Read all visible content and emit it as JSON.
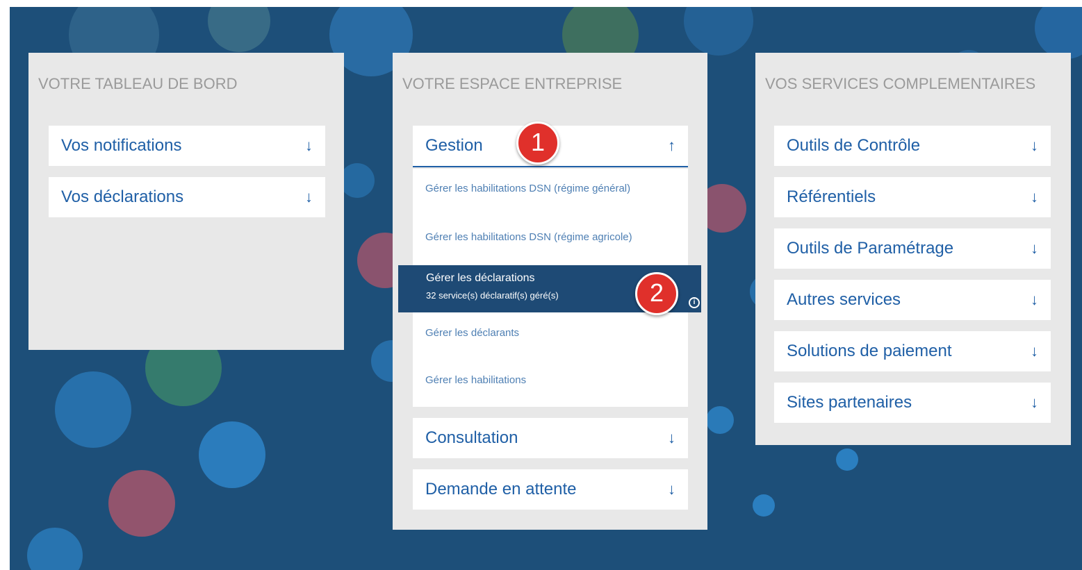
{
  "panels": {
    "dashboard": {
      "title": "VOTRE TABLEAU DE BORD",
      "items": [
        {
          "label": "Vos notifications",
          "arrow": "↓"
        },
        {
          "label": "Vos déclarations",
          "arrow": "↓"
        }
      ]
    },
    "company": {
      "title": "VOTRE ESPACE ENTREPRISE",
      "gestion": {
        "label": "Gestion",
        "arrow": "↑"
      },
      "submenu": {
        "item1": "Gérer les habilitations DSN (régime général)",
        "item2": "Gérer les habilitations DSN (régime agricole)",
        "active_label": "Gérer les déclarations",
        "active_sub": "32 service(s) déclaratif(s) géré(s)",
        "item4": "Gérer les déclarants",
        "item5": "Gérer les habilitations"
      },
      "items": [
        {
          "label": "Consultation",
          "arrow": "↓"
        },
        {
          "label": "Demande en attente",
          "arrow": "↓"
        }
      ]
    },
    "services": {
      "title": "VOS SERVICES COMPLEMENTAIRES",
      "items": [
        {
          "label": "Outils de Contrôle",
          "arrow": "↓"
        },
        {
          "label": "Référentiels",
          "arrow": "↓"
        },
        {
          "label": "Outils de Paramétrage",
          "arrow": "↓"
        },
        {
          "label": "Autres services",
          "arrow": "↓"
        },
        {
          "label": "Solutions de paiement",
          "arrow": "↓"
        },
        {
          "label": "Sites partenaires",
          "arrow": "↓"
        }
      ]
    }
  },
  "badges": {
    "one": "1",
    "two": "2",
    "info_icon": "i"
  },
  "colors": {
    "background": "#1d4f79",
    "panel": "#e8e8e8",
    "link": "#1f5fa6",
    "highlight": "#1e4a75",
    "badge": "#e0302b"
  }
}
